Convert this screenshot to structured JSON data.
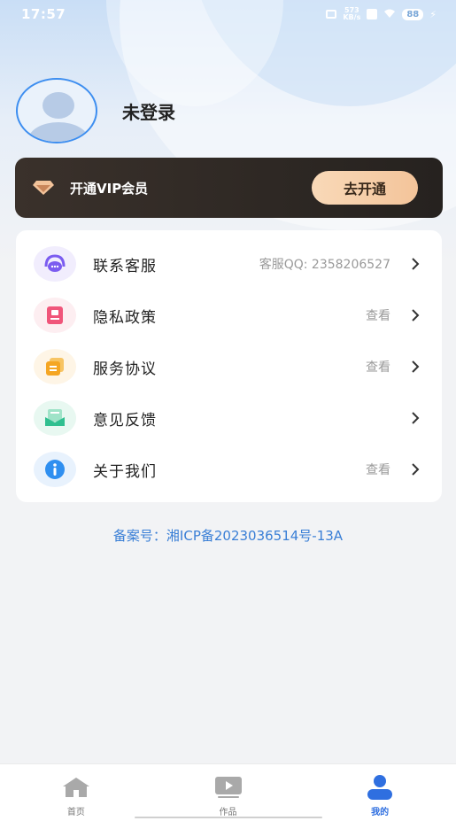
{
  "status_bar": {
    "time": "17:57",
    "net_speed_value": "573",
    "net_speed_unit": "KB/s",
    "battery": "88",
    "icons": [
      "vibrate-icon",
      "netspeed-icon",
      "notification-box-icon",
      "wifi-icon",
      "battery-icon",
      "charging-icon"
    ]
  },
  "profile": {
    "username": "未登录"
  },
  "vip": {
    "label": "开通VIP会员",
    "button_label": "去开通",
    "icon": "diamond-icon",
    "accent": "#f5c9a0"
  },
  "menu": {
    "items": [
      {
        "label": "联系客服",
        "value": "客服QQ: 2358206527",
        "icon": "customer-service-icon",
        "color": "#7b5cf0",
        "bg": "#f1edfd"
      },
      {
        "label": "隐私政策",
        "value": "查看",
        "icon": "privacy-icon",
        "color": "#f0557a",
        "bg": "#fdeef1"
      },
      {
        "label": "服务协议",
        "value": "查看",
        "icon": "agreement-icon",
        "color": "#f5a623",
        "bg": "#fef5e6"
      },
      {
        "label": "意见反馈",
        "value": "",
        "icon": "feedback-icon",
        "color": "#2fbf8f",
        "bg": "#e8f8f1"
      },
      {
        "label": "关于我们",
        "value": "查看",
        "icon": "info-icon",
        "color": "#2f8ff0",
        "bg": "#e8f2fd"
      }
    ]
  },
  "icp": "备案号：湘ICP备2023036514号-13A",
  "bottom_nav": {
    "items": [
      {
        "label": "首页",
        "icon": "home-icon",
        "active": false
      },
      {
        "label": "作品",
        "icon": "works-icon",
        "active": false
      },
      {
        "label": "我的",
        "icon": "profile-icon",
        "active": true
      }
    ],
    "active_color": "#2f6fe0"
  }
}
